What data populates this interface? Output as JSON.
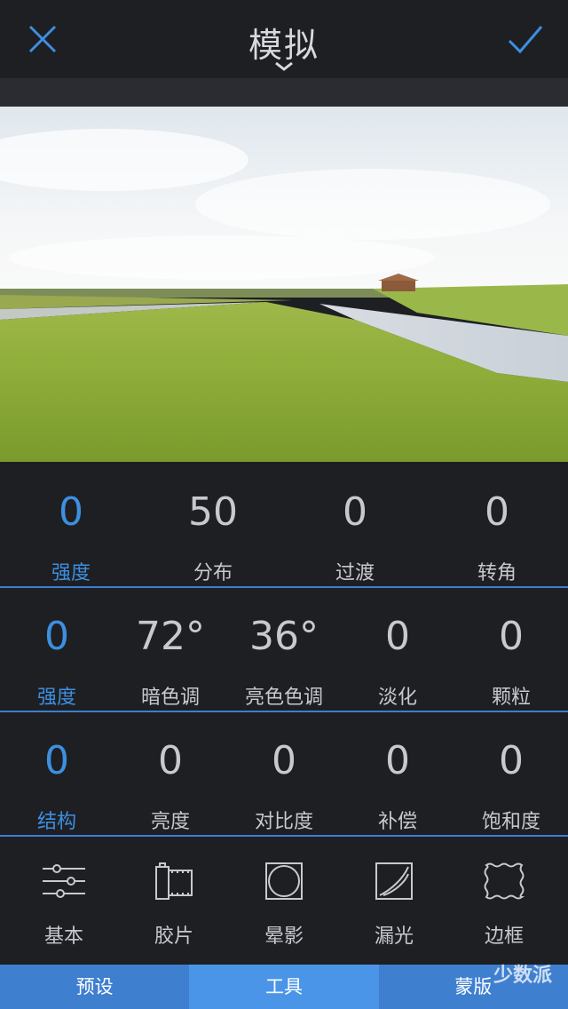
{
  "header": {
    "title": "模拟"
  },
  "row1": [
    {
      "value": "0",
      "label": "强度",
      "active": true
    },
    {
      "value": "50",
      "label": "分布"
    },
    {
      "value": "0",
      "label": "过渡"
    },
    {
      "value": "0",
      "label": "转角"
    }
  ],
  "row2": [
    {
      "value": "0",
      "label": "强度",
      "active": true
    },
    {
      "value": "72°",
      "label": "暗色调"
    },
    {
      "value": "36°",
      "label": "亮色色调"
    },
    {
      "value": "0",
      "label": "淡化"
    },
    {
      "value": "0",
      "label": "颗粒"
    }
  ],
  "row3": [
    {
      "value": "0",
      "label": "结构",
      "active": true
    },
    {
      "value": "0",
      "label": "亮度"
    },
    {
      "value": "0",
      "label": "对比度"
    },
    {
      "value": "0",
      "label": "补偿"
    },
    {
      "value": "0",
      "label": "饱和度"
    }
  ],
  "tools": [
    {
      "label": "基本",
      "icon": "sliders-icon"
    },
    {
      "label": "胶片",
      "icon": "film-icon"
    },
    {
      "label": "晕影",
      "icon": "vignette-icon"
    },
    {
      "label": "漏光",
      "icon": "light-leak-icon"
    },
    {
      "label": "边框",
      "icon": "border-icon"
    }
  ],
  "tabs": [
    {
      "label": "预设"
    },
    {
      "label": "工具",
      "active": true
    },
    {
      "label": "蒙版"
    }
  ],
  "watermark": "少数派",
  "colors": {
    "accent": "#3d8fe0",
    "background": "#1e1f23",
    "tabbar": "#3f7fd0"
  }
}
